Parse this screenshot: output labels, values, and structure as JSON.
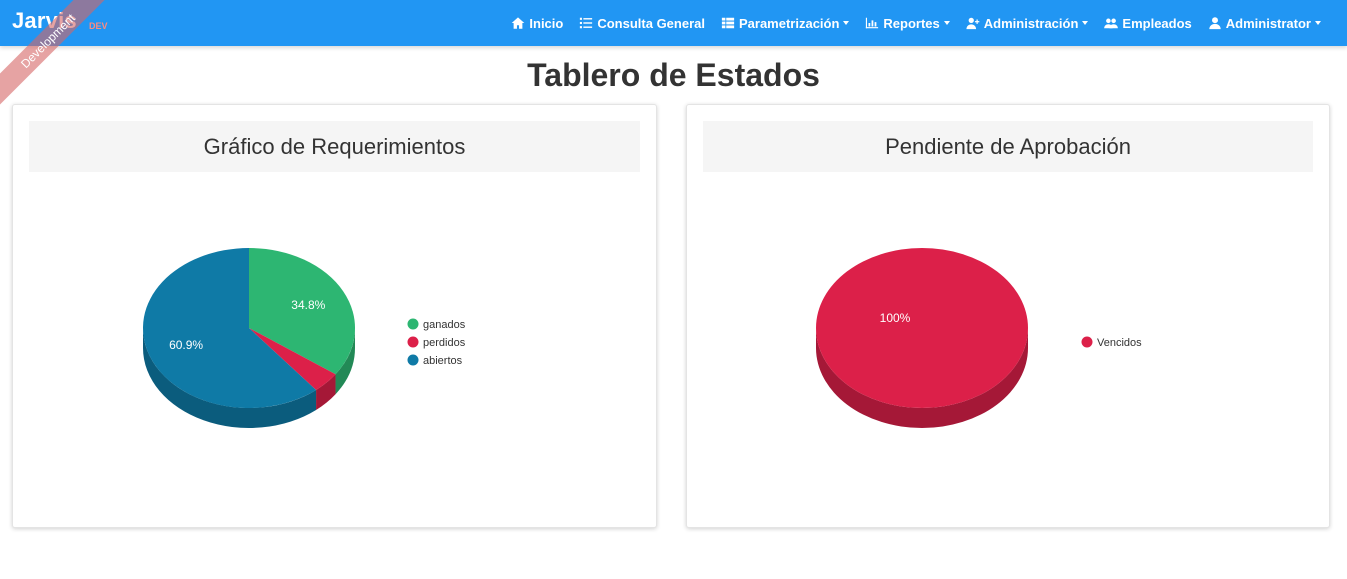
{
  "brand": {
    "name": "Jarvis",
    "env": "DEV",
    "ribbon": "Development"
  },
  "nav": {
    "items": [
      {
        "id": "inicio",
        "label": "Inicio",
        "icon": "home-icon",
        "dropdown": false
      },
      {
        "id": "consulta",
        "label": "Consulta General",
        "icon": "list-icon",
        "dropdown": false
      },
      {
        "id": "parametrizacion",
        "label": "Parametrización",
        "icon": "table-icon",
        "dropdown": true
      },
      {
        "id": "reportes",
        "label": "Reportes",
        "icon": "bar-chart-icon",
        "dropdown": true
      },
      {
        "id": "administracion",
        "label": "Administración",
        "icon": "user-plus-icon",
        "dropdown": true
      },
      {
        "id": "empleados",
        "label": "Empleados",
        "icon": "users-icon",
        "dropdown": false
      },
      {
        "id": "user",
        "label": "Administrator",
        "icon": "user-icon",
        "dropdown": true
      }
    ]
  },
  "page": {
    "title": "Tablero de Estados"
  },
  "colors": {
    "navbar": "#2196f3",
    "green": "#2db672",
    "red": "#dc2049",
    "blue": "#0f7aa6"
  },
  "chart_data": [
    {
      "type": "pie",
      "title": "Gráfico de Requerimientos",
      "slices": [
        {
          "name": "ganados",
          "value": 34.8,
          "label": "34.8%",
          "color": "#2db672"
        },
        {
          "name": "perdidos",
          "value": 4.3,
          "label": "",
          "color": "#dc2049"
        },
        {
          "name": "abiertos",
          "value": 60.9,
          "label": "60.9%",
          "color": "#0f7aa6"
        }
      ],
      "legend": "right"
    },
    {
      "type": "pie",
      "title": "Pendiente de Aprobación",
      "slices": [
        {
          "name": "Vencidos",
          "value": 100,
          "label": "100%",
          "color": "#dc2049"
        }
      ],
      "legend": "right"
    }
  ]
}
